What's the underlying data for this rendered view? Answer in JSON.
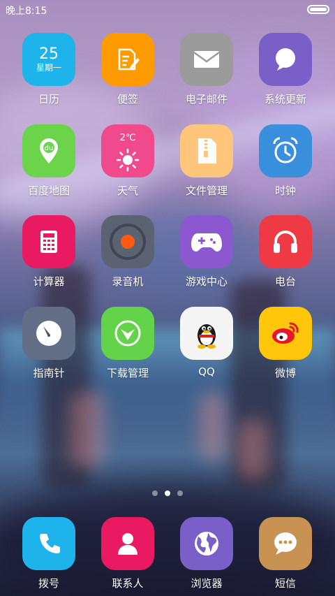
{
  "status_bar": {
    "time": "晚上8:15"
  },
  "apps": {
    "calendar": {
      "label": "日历",
      "day": "25",
      "weekday": "星期一",
      "color": "#1fb3ec"
    },
    "notes": {
      "label": "便签",
      "color": "#ff9a00"
    },
    "email": {
      "label": "电子邮件",
      "color": "#9b9b9b"
    },
    "system_update": {
      "label": "系统更新",
      "color": "#7a5fc8"
    },
    "baidu_map": {
      "label": "百度地图",
      "color": "#6bd44a",
      "badge": "du"
    },
    "weather": {
      "label": "天气",
      "temp": "2℃",
      "color": "#f04a8c"
    },
    "file_manager": {
      "label": "文件管理",
      "color": "#ffc57a"
    },
    "clock": {
      "label": "时钟",
      "color": "#3a8fdc"
    },
    "calculator": {
      "label": "计算器",
      "color": "#ea1a62"
    },
    "recorder": {
      "label": "录音机",
      "color": "#5b6373"
    },
    "game_center": {
      "label": "游戏中心",
      "color": "#8c58d0"
    },
    "radio": {
      "label": "电台",
      "color": "#ef3a45"
    },
    "compass": {
      "label": "指南针",
      "color": "#636f86"
    },
    "download_manager": {
      "label": "下载管理",
      "color": "#63d34a"
    },
    "qq": {
      "label": "QQ",
      "color": "#f5f5f5"
    },
    "weibo": {
      "label": "微博",
      "color": "#ffc60a"
    }
  },
  "page_indicator": {
    "count": 3,
    "active": 2
  },
  "dock": {
    "dialer": {
      "label": "拨号",
      "color": "#1fb3ec"
    },
    "contacts": {
      "label": "联系人",
      "color": "#ea1a62"
    },
    "browser": {
      "label": "浏览器",
      "color": "#7a5fc8"
    },
    "messages": {
      "label": "短信",
      "color": "#c89352"
    }
  }
}
